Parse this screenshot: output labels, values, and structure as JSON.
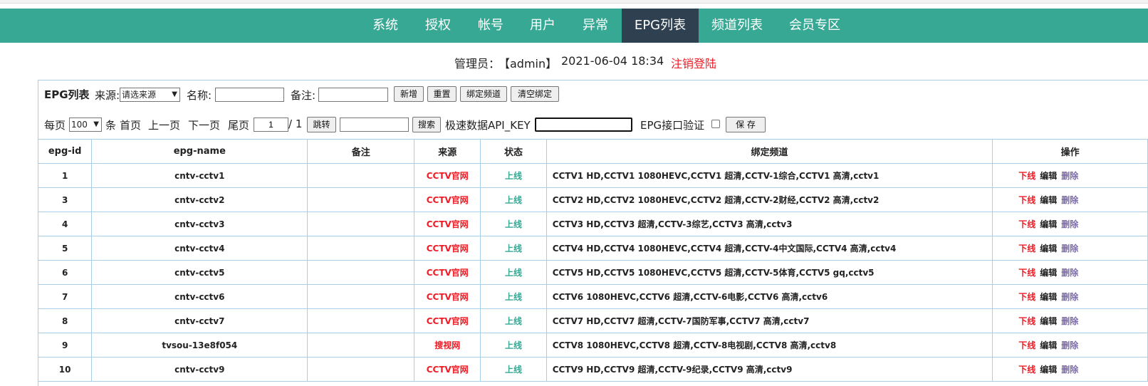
{
  "nav": {
    "items": [
      "系统",
      "授权",
      "帐号",
      "用户",
      "异常",
      "EPG列表",
      "频道列表",
      "会员专区"
    ],
    "active": "EPG列表"
  },
  "admin": {
    "label": "管理员：",
    "user": "【admin】",
    "datetime": "2021-06-04 18:34",
    "logout": "注销登陆"
  },
  "toolbar": {
    "title": "EPG列表",
    "source_label": "来源:",
    "source_value": "请选来源",
    "name_label": "名称:",
    "remark_label": "备注:",
    "add_button": "新增",
    "reset_button": "重置",
    "bind_button": "绑定频道",
    "clear_bind_button": "清空绑定"
  },
  "pager": {
    "per_page_label": "每页",
    "per_page_value": "100",
    "unit": "条",
    "first": "首页",
    "prev": "上一页",
    "next": "下一页",
    "last": "尾页",
    "current_page": "1",
    "total": "/ 1",
    "jump_button": "跳转",
    "search_button": "搜索",
    "api_key_label": "极速数据API_KEY",
    "epg_verify_label": "EPG接口验证",
    "save_button": "保 存"
  },
  "table": {
    "headers": [
      "epg-id",
      "epg-name",
      "备注",
      "来源",
      "状态",
      "绑定频道",
      "操作"
    ],
    "rows": [
      {
        "id": "1",
        "name": "cntv-cctv1",
        "remark": "",
        "source": "CCTV官网",
        "status": "上线",
        "channels": "CCTV1 HD,CCTV1 1080HEVC,CCTV1 超清,CCTV-1综合,CCTV1 高清,cctv1"
      },
      {
        "id": "3",
        "name": "cntv-cctv2",
        "remark": "",
        "source": "CCTV官网",
        "status": "上线",
        "channels": "CCTV2 HD,CCTV2 1080HEVC,CCTV2 超清,CCTV-2财经,CCTV2 高清,cctv2"
      },
      {
        "id": "4",
        "name": "cntv-cctv3",
        "remark": "",
        "source": "CCTV官网",
        "status": "上线",
        "channels": "CCTV3 HD,CCTV3 超清,CCTV-3综艺,CCTV3 高清,cctv3"
      },
      {
        "id": "5",
        "name": "cntv-cctv4",
        "remark": "",
        "source": "CCTV官网",
        "status": "上线",
        "channels": "CCTV4 HD,CCTV4 1080HEVC,CCTV4 超清,CCTV-4中文国际,CCTV4 高清,cctv4"
      },
      {
        "id": "6",
        "name": "cntv-cctv5",
        "remark": "",
        "source": "CCTV官网",
        "status": "上线",
        "channels": "CCTV5 HD,CCTV5 1080HEVC,CCTV5 超清,CCTV-5体育,CCTV5 gq,cctv5"
      },
      {
        "id": "7",
        "name": "cntv-cctv6",
        "remark": "",
        "source": "CCTV官网",
        "status": "上线",
        "channels": "CCTV6 1080HEVC,CCTV6 超清,CCTV-6电影,CCTV6 高清,cctv6"
      },
      {
        "id": "8",
        "name": "cntv-cctv7",
        "remark": "",
        "source": "CCTV官网",
        "status": "上线",
        "channels": "CCTV7 HD,CCTV7 超清,CCTV-7国防军事,CCTV7 高清,cctv7"
      },
      {
        "id": "9",
        "name": "tvsou-13e8f054",
        "remark": "",
        "source": "搜视网",
        "status": "上线",
        "channels": "CCTV8 1080HEVC,CCTV8 超清,CCTV-8电视剧,CCTV8 高清,cctv8"
      },
      {
        "id": "10",
        "name": "cntv-cctv9",
        "remark": "",
        "source": "CCTV官网",
        "status": "上线",
        "channels": "CCTV9 HD,CCTV9 超清,CCTV-9纪录,CCTV9 高清,cctv9"
      }
    ],
    "actions": {
      "offline": "下线",
      "edit": "编辑",
      "delete": "删除"
    }
  },
  "colors": {
    "nav_bg": "#36a894",
    "nav_active": "#2f4050",
    "red": "#ee1c25",
    "green": "#36a894",
    "purple": "#7b6aa8"
  }
}
